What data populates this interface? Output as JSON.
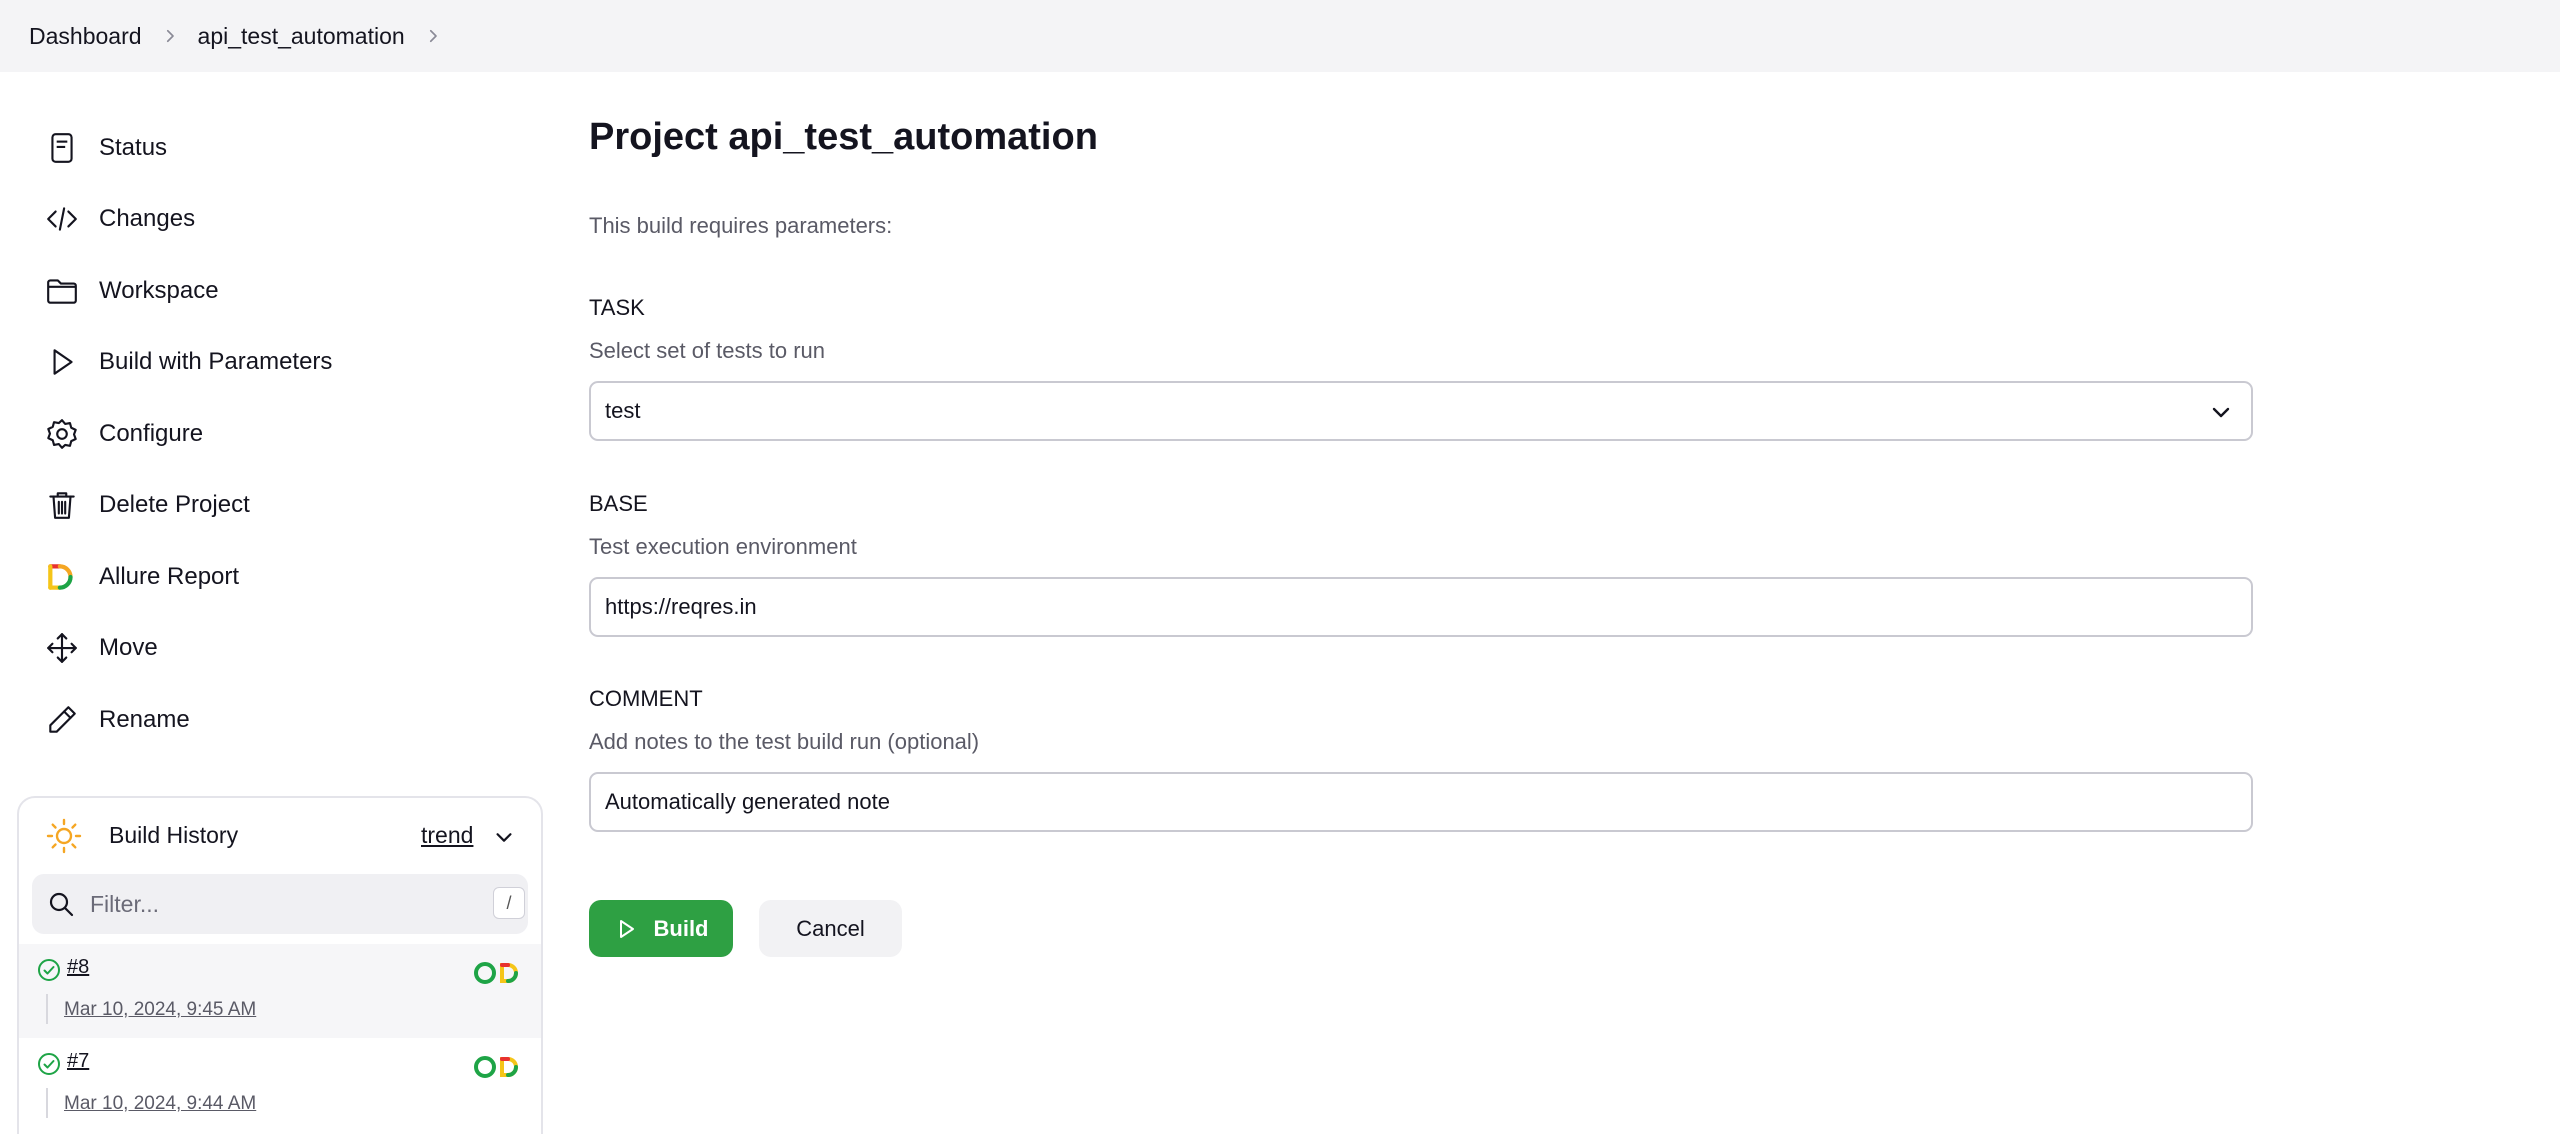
{
  "breadcrumb": {
    "items": [
      {
        "label": "Dashboard"
      },
      {
        "label": "api_test_automation"
      }
    ]
  },
  "sidebar": {
    "items": [
      {
        "label": "Status",
        "icon": "document-icon"
      },
      {
        "label": "Changes",
        "icon": "code-icon"
      },
      {
        "label": "Workspace",
        "icon": "folder-icon"
      },
      {
        "label": "Build with Parameters",
        "icon": "play-icon"
      },
      {
        "label": "Configure",
        "icon": "gear-icon"
      },
      {
        "label": "Delete Project",
        "icon": "trash-icon"
      },
      {
        "label": "Allure Report",
        "icon": "allure-icon"
      },
      {
        "label": "Move",
        "icon": "move-arrows-icon"
      },
      {
        "label": "Rename",
        "icon": "pencil-icon"
      }
    ]
  },
  "build_history": {
    "title": "Build History",
    "trend_label": "trend",
    "filter_placeholder": "Filter...",
    "filter_shortcut": "/",
    "builds": [
      {
        "number": "#8",
        "date": "Mar 10, 2024, 9:45 AM",
        "status": "success"
      },
      {
        "number": "#7",
        "date": "Mar 10, 2024, 9:44 AM",
        "status": "success"
      }
    ]
  },
  "main": {
    "title": "Project api_test_automation",
    "intro": "This build requires parameters:",
    "params": [
      {
        "name": "TASK",
        "description": "Select set of tests to run",
        "type": "select",
        "value": "test"
      },
      {
        "name": "BASE",
        "description": "Test execution environment",
        "type": "text",
        "value": "https://reqres.in"
      },
      {
        "name": "COMMENT",
        "description": "Add notes to the test build run (optional)",
        "type": "text",
        "value": "Automatically generated note"
      }
    ],
    "build_button": "Build",
    "cancel_button": "Cancel"
  },
  "colors": {
    "accent_green": "#2ea043",
    "topbar_bg": "#f4f4f6",
    "success": "#1ea446",
    "sun": "#f5a623"
  }
}
